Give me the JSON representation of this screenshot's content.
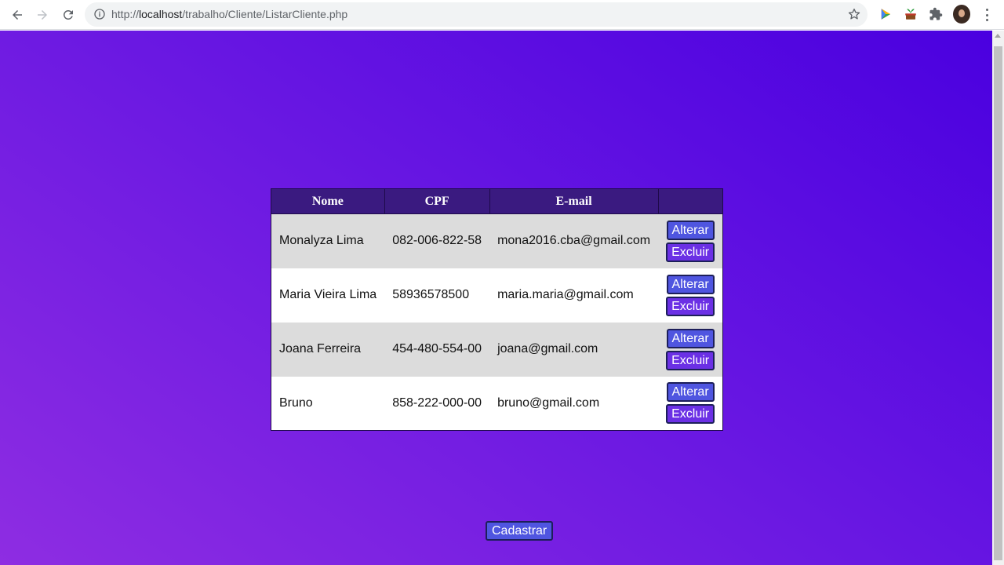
{
  "browser": {
    "url_prefix": "http://",
    "url_host": "localhost",
    "url_path": "/trabalho/Cliente/ListarCliente.php"
  },
  "table": {
    "headers": [
      "Nome",
      "CPF",
      "E-mail",
      ""
    ],
    "rows": [
      {
        "nome": "Monalyza Lima",
        "cpf": "082-006-822-58",
        "email": "mona2016.cba@gmail.com",
        "alterar": "Alterar",
        "excluir": "Excluir"
      },
      {
        "nome": "Maria Vieira Lima",
        "cpf": "58936578500",
        "email": "maria.maria@gmail.com",
        "alterar": "Alterar",
        "excluir": "Excluir"
      },
      {
        "nome": "Joana Ferreira",
        "cpf": "454-480-554-00",
        "email": "joana@gmail.com",
        "alterar": "Alterar",
        "excluir": "Excluir"
      },
      {
        "nome": "Bruno",
        "cpf": "858-222-000-00",
        "email": "bruno@gmail.com",
        "alterar": "Alterar",
        "excluir": "Excluir"
      }
    ]
  },
  "cadastrar_label": "Cadastrar",
  "colors": {
    "gradient_start": "#8e2de2",
    "gradient_end": "#4a00e0",
    "header_bg": "#3a1a80",
    "button_bg": "#4f55e0",
    "row_alt_bg": "#dcdcdc"
  },
  "icons": {
    "back": "back-arrow-icon",
    "forward": "forward-arrow-icon",
    "reload": "reload-icon",
    "info": "info-icon",
    "bookmark": "star-icon",
    "extensions": "puzzle-icon",
    "menu": "kebab-menu-icon"
  }
}
